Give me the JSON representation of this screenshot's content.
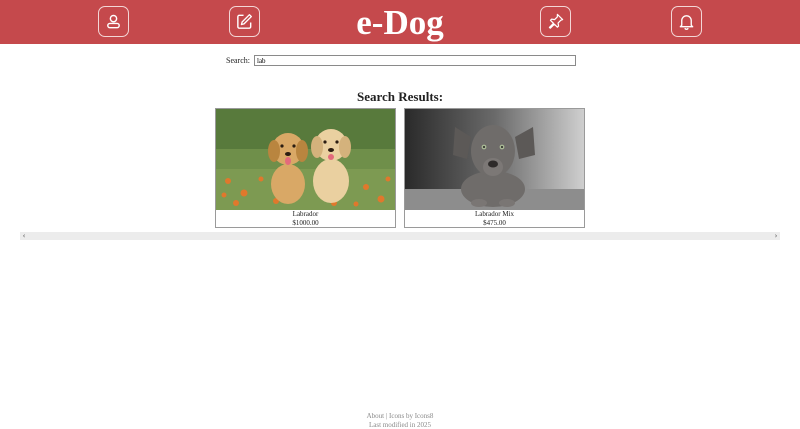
{
  "header": {
    "logo": "e-Dog",
    "icons": [
      "user-icon",
      "edit-icon",
      "pin-icon",
      "bell-icon"
    ],
    "colors": {
      "bar": "#c5494c",
      "text": "#ffffff"
    }
  },
  "search": {
    "label": "Search:",
    "value": "lab"
  },
  "results": {
    "title": "Search Results:",
    "items": [
      {
        "name": "Labrador",
        "price": "$1000.00"
      },
      {
        "name": "Labrador Mix",
        "price": "$475.00"
      }
    ]
  },
  "footer": {
    "about_label": "About",
    "separator": "|",
    "icons_credit": "Icons by Icons8",
    "modified": "Last modified in 2025"
  }
}
